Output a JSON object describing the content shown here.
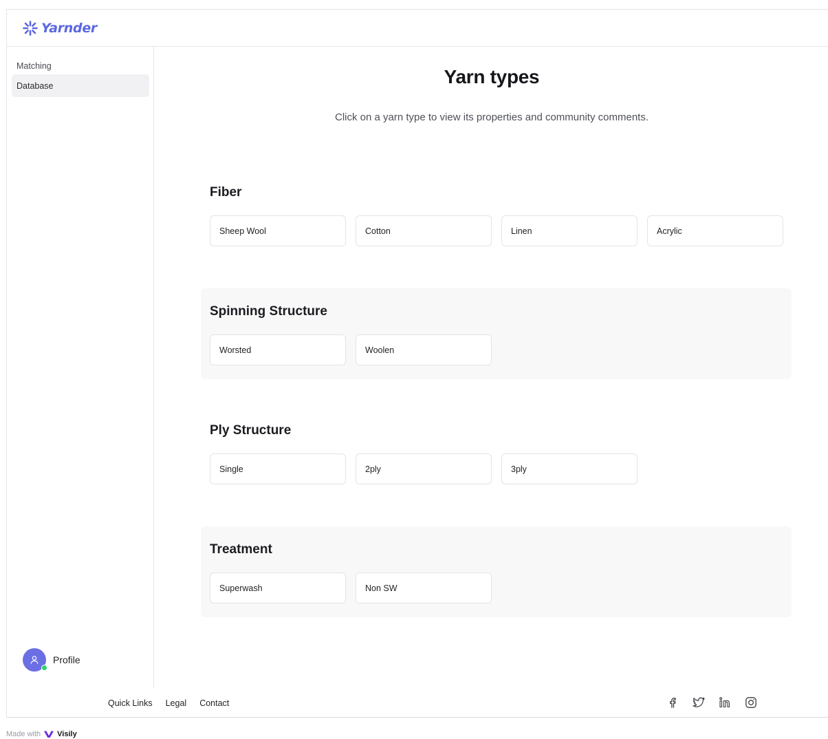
{
  "app": {
    "brand": "Yarnder",
    "brand_color": "#5b67e0"
  },
  "sidebar": {
    "items": [
      {
        "label": "Matching",
        "active": false
      },
      {
        "label": "Database",
        "active": true
      }
    ],
    "profile_label": "Profile",
    "status_color": "#2ed36b"
  },
  "main": {
    "title": "Yarn types",
    "subtitle": "Click on a yarn type to view its properties and community comments.",
    "sections": [
      {
        "title": "Fiber",
        "items": [
          "Sheep Wool",
          "Cotton",
          "Linen",
          "Acrylic"
        ]
      },
      {
        "title": "Spinning Structure",
        "items": [
          "Worsted",
          "Woolen"
        ]
      },
      {
        "title": "Ply Structure",
        "items": [
          "Single",
          "2ply",
          "3ply"
        ]
      },
      {
        "title": "Treatment",
        "items": [
          "Superwash",
          "Non SW"
        ]
      }
    ]
  },
  "footer": {
    "links": [
      "Quick Links",
      "Legal",
      "Contact"
    ],
    "socials": [
      "facebook-icon",
      "twitter-icon",
      "linkedin-icon",
      "instagram-icon"
    ]
  },
  "watermark": {
    "prefix": "Made with",
    "name": "Visily"
  }
}
